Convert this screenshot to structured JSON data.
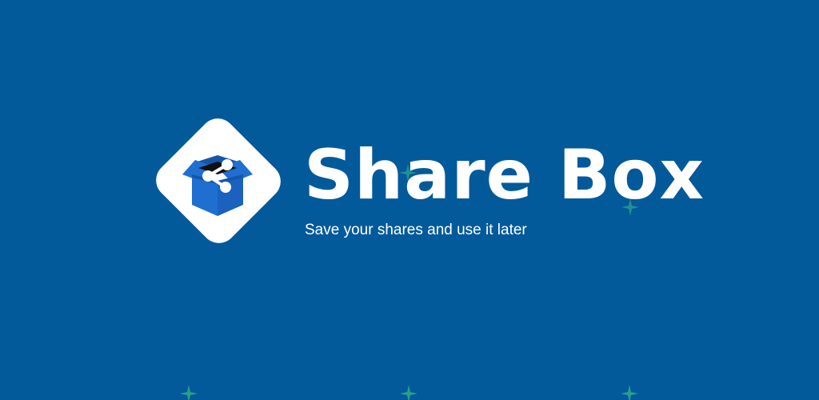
{
  "brand": {
    "title": "Share Box",
    "tagline": "Save your shares and use it later"
  },
  "logo": {
    "icon": "share-box-icon",
    "tile_color": "#ffffff",
    "box_color": "#1f6fd1",
    "box_dark_color": "#1656a8"
  },
  "colors": {
    "background": "#035a9a",
    "sparkle": "#2a9d8f",
    "text": "#ffffff"
  },
  "decorations": {
    "sparkle_icon": "sparkle-icon"
  }
}
